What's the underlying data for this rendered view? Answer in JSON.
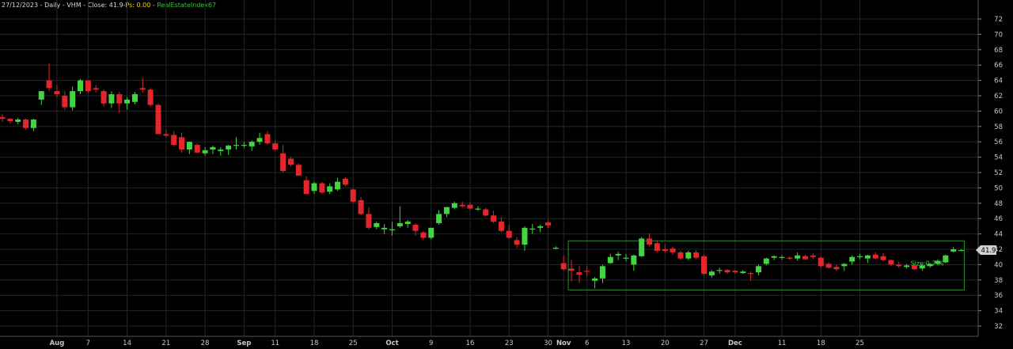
{
  "header": {
    "date": "27/12/2023",
    "interval": "Daily",
    "symbol": "VHM",
    "close_label": "Close: 41.9",
    "ps_label": "-Ps: 0.00",
    "index_label": "RealEstateIndex67"
  },
  "colors": {
    "background": "#000000",
    "up": "#3fd63f",
    "down": "#e3262b",
    "grid": "#262626",
    "box": "#2f8a2f",
    "axis_text": "#c8c8c8",
    "price_tag": "#d0d0d0"
  },
  "price_tag": "41.9",
  "box_label": "Size:0.7 %",
  "chart_data": {
    "type": "candlestick",
    "ylim": [
      30,
      74
    ],
    "yticks": [
      32,
      34,
      36,
      38,
      40,
      42,
      44,
      46,
      48,
      50,
      52,
      54,
      56,
      58,
      60,
      62,
      64,
      66,
      68,
      70,
      72
    ],
    "x_labels": [
      {
        "label": "Aug",
        "bold": true,
        "i": 7
      },
      {
        "label": "7",
        "i": 11
      },
      {
        "label": "14",
        "i": 16
      },
      {
        "label": "21",
        "i": 21
      },
      {
        "label": "28",
        "i": 26
      },
      {
        "label": "Sep",
        "bold": true,
        "i": 31
      },
      {
        "label": "11",
        "i": 35
      },
      {
        "label": "18",
        "i": 40
      },
      {
        "label": "25",
        "i": 45
      },
      {
        "label": "Oct",
        "bold": true,
        "i": 50
      },
      {
        "label": "9",
        "i": 55
      },
      {
        "label": "16",
        "i": 60
      },
      {
        "label": "23",
        "i": 65
      },
      {
        "label": "30",
        "i": 70
      },
      {
        "label": "Nov",
        "bold": true,
        "i": 72
      },
      {
        "label": "6",
        "i": 75
      },
      {
        "label": "13",
        "i": 80
      },
      {
        "label": "20",
        "i": 85
      },
      {
        "label": "27",
        "i": 90
      },
      {
        "label": "Dec",
        "bold": true,
        "i": 94
      },
      {
        "label": "11",
        "i": 100
      },
      {
        "label": "18",
        "i": 105
      },
      {
        "label": "25",
        "i": 110
      }
    ],
    "candles": [
      [
        59.2,
        59.6,
        58.6,
        59.0
      ],
      [
        59.0,
        59.1,
        58.4,
        58.7
      ],
      [
        58.6,
        59.1,
        58.3,
        58.9
      ],
      [
        58.9,
        59.0,
        57.6,
        57.8
      ],
      [
        57.8,
        59.0,
        57.4,
        58.9
      ],
      [
        61.5,
        62.6,
        60.8,
        62.6
      ],
      [
        64.0,
        66.2,
        62.6,
        63.0
      ],
      [
        62.6,
        63.4,
        61.8,
        62.2
      ],
      [
        62.0,
        62.6,
        60.2,
        60.5
      ],
      [
        60.5,
        63.2,
        60.1,
        62.6
      ],
      [
        62.6,
        64.2,
        62.2,
        64.0
      ],
      [
        64.0,
        64.0,
        62.4,
        62.6
      ],
      [
        63.0,
        63.4,
        62.4,
        62.8
      ],
      [
        62.6,
        62.8,
        60.6,
        61.0
      ],
      [
        61.0,
        62.6,
        60.4,
        62.2
      ],
      [
        62.2,
        62.5,
        59.8,
        61.0
      ],
      [
        61.0,
        61.8,
        60.2,
        61.5
      ],
      [
        61.2,
        62.5,
        60.9,
        62.2
      ],
      [
        63.0,
        64.3,
        62.4,
        62.8
      ],
      [
        62.8,
        63.0,
        60.6,
        60.8
      ],
      [
        60.8,
        61.0,
        57.0,
        57.0
      ],
      [
        57.0,
        57.6,
        56.6,
        56.8
      ],
      [
        56.9,
        57.4,
        55.4,
        55.6
      ],
      [
        56.6,
        57.2,
        54.6,
        55.0
      ],
      [
        55.0,
        56.0,
        54.4,
        56.0
      ],
      [
        55.6,
        55.8,
        54.5,
        54.6
      ],
      [
        54.5,
        55.3,
        54.2,
        54.9
      ],
      [
        55.0,
        55.5,
        54.4,
        55.3
      ],
      [
        54.8,
        55.3,
        54.2,
        55.0
      ],
      [
        55.0,
        55.6,
        54.3,
        55.5
      ],
      [
        55.5,
        56.6,
        55.0,
        55.6
      ],
      [
        55.6,
        56.0,
        55.2,
        55.6
      ],
      [
        55.4,
        56.2,
        54.8,
        56.0
      ],
      [
        56.0,
        57.2,
        55.6,
        56.5
      ],
      [
        57.0,
        57.4,
        55.6,
        55.8
      ],
      [
        55.8,
        56.2,
        54.8,
        55.0
      ],
      [
        54.5,
        55.6,
        52.0,
        52.2
      ],
      [
        53.8,
        54.0,
        52.8,
        53.0
      ],
      [
        53.0,
        53.2,
        51.6,
        51.6
      ],
      [
        51.0,
        51.5,
        49.2,
        49.2
      ],
      [
        49.6,
        50.8,
        49.2,
        50.6
      ],
      [
        50.6,
        50.8,
        49.2,
        49.4
      ],
      [
        49.5,
        50.6,
        49.2,
        50.2
      ],
      [
        49.8,
        51.3,
        49.6,
        50.8
      ],
      [
        51.2,
        51.4,
        50.2,
        50.4
      ],
      [
        49.8,
        49.9,
        48.0,
        48.2
      ],
      [
        48.4,
        48.8,
        46.4,
        46.6
      ],
      [
        46.6,
        47.5,
        44.6,
        44.8
      ],
      [
        44.9,
        45.6,
        44.6,
        45.4
      ],
      [
        44.6,
        45.3,
        44.0,
        44.8
      ],
      [
        44.6,
        45.6,
        43.8,
        44.6
      ],
      [
        45.0,
        47.6,
        44.8,
        45.4
      ],
      [
        45.3,
        45.8,
        44.8,
        45.6
      ],
      [
        45.2,
        45.4,
        43.8,
        44.4
      ],
      [
        44.2,
        44.4,
        43.2,
        43.5
      ],
      [
        43.5,
        44.8,
        43.3,
        44.8
      ],
      [
        45.4,
        47.1,
        45.2,
        46.6
      ],
      [
        46.6,
        47.5,
        46.2,
        47.5
      ],
      [
        47.4,
        48.2,
        47.2,
        48.0
      ],
      [
        47.8,
        48.2,
        47.4,
        47.6
      ],
      [
        47.8,
        48.1,
        47.1,
        47.3
      ],
      [
        47.3,
        47.6,
        47.0,
        47.3
      ],
      [
        47.2,
        47.4,
        46.3,
        46.4
      ],
      [
        46.4,
        47.0,
        45.4,
        45.6
      ],
      [
        45.6,
        46.2,
        44.2,
        44.4
      ],
      [
        44.4,
        45.2,
        43.4,
        43.5
      ],
      [
        43.2,
        43.6,
        42.2,
        42.6
      ],
      [
        42.6,
        45.0,
        41.8,
        44.8
      ],
      [
        44.6,
        45.3,
        44.0,
        44.7
      ],
      [
        44.8,
        45.2,
        44.2,
        45.0
      ],
      [
        45.5,
        45.8,
        44.8,
        45.1
      ],
      [
        42.2,
        42.4,
        42.0,
        42.2
      ],
      [
        40.2,
        41.2,
        39.2,
        39.4
      ],
      [
        39.5,
        40.6,
        37.8,
        39.2
      ],
      [
        39.0,
        39.8,
        37.6,
        38.7
      ],
      [
        39.2,
        39.8,
        38.5,
        39.1
      ],
      [
        37.9,
        38.4,
        36.9,
        38.2
      ],
      [
        38.2,
        40.0,
        37.6,
        39.8
      ],
      [
        40.2,
        41.4,
        40.1,
        41.0
      ],
      [
        41.2,
        41.7,
        40.6,
        41.4
      ],
      [
        40.8,
        41.4,
        40.4,
        40.9
      ],
      [
        40.0,
        41.3,
        39.2,
        41.2
      ],
      [
        41.1,
        43.6,
        41.0,
        43.4
      ],
      [
        43.4,
        44.1,
        42.4,
        42.6
      ],
      [
        42.8,
        43.1,
        41.6,
        41.8
      ],
      [
        42.0,
        42.6,
        41.6,
        41.8
      ],
      [
        42.1,
        42.3,
        41.3,
        41.6
      ],
      [
        41.6,
        41.8,
        40.6,
        40.8
      ],
      [
        40.8,
        41.8,
        40.6,
        41.6
      ],
      [
        41.6,
        41.9,
        40.7,
        40.9
      ],
      [
        41.1,
        41.3,
        38.6,
        38.8
      ],
      [
        38.6,
        39.3,
        38.3,
        39.1
      ],
      [
        39.2,
        39.6,
        38.8,
        39.3
      ],
      [
        39.3,
        39.4,
        38.8,
        39.0
      ],
      [
        39.2,
        39.3,
        38.8,
        39.0
      ],
      [
        38.9,
        39.3,
        38.8,
        39.1
      ],
      [
        38.9,
        39.1,
        37.9,
        38.8
      ],
      [
        39.0,
        40.0,
        38.6,
        39.8
      ],
      [
        40.1,
        40.9,
        39.9,
        40.8
      ],
      [
        40.9,
        41.2,
        40.6,
        41.1
      ],
      [
        41.0,
        41.2,
        40.6,
        41.0
      ],
      [
        40.9,
        41.1,
        40.6,
        40.8
      ],
      [
        40.8,
        41.6,
        40.5,
        41.2
      ],
      [
        41.1,
        41.3,
        40.6,
        40.7
      ],
      [
        41.2,
        41.5,
        40.8,
        41.0
      ],
      [
        40.9,
        41.1,
        39.6,
        39.8
      ],
      [
        40.1,
        40.3,
        39.5,
        39.6
      ],
      [
        39.7,
        40.0,
        39.2,
        39.4
      ],
      [
        39.8,
        40.2,
        39.2,
        40.1
      ],
      [
        40.4,
        41.2,
        40.0,
        41.0
      ],
      [
        41.0,
        41.4,
        40.7,
        41.1
      ],
      [
        40.8,
        41.3,
        40.2,
        41.2
      ],
      [
        41.3,
        41.6,
        40.7,
        40.8
      ],
      [
        41.1,
        41.5,
        40.4,
        40.6
      ],
      [
        40.6,
        40.7,
        39.8,
        40.0
      ],
      [
        40.0,
        40.4,
        39.6,
        39.8
      ],
      [
        39.7,
        40.1,
        39.5,
        39.9
      ],
      [
        39.9,
        40.0,
        39.3,
        39.4
      ],
      [
        39.5,
        40.0,
        39.2,
        39.9
      ],
      [
        39.8,
        40.2,
        39.6,
        40.1
      ],
      [
        40.1,
        40.7,
        39.9,
        40.5
      ],
      [
        40.3,
        41.3,
        40.2,
        41.2
      ],
      [
        41.7,
        42.3,
        41.6,
        42.0
      ],
      [
        41.9,
        42.0,
        41.8,
        41.9
      ]
    ],
    "box": {
      "start_i": 73,
      "end_i": 123,
      "top": 43.1,
      "bottom": 36.7
    }
  }
}
